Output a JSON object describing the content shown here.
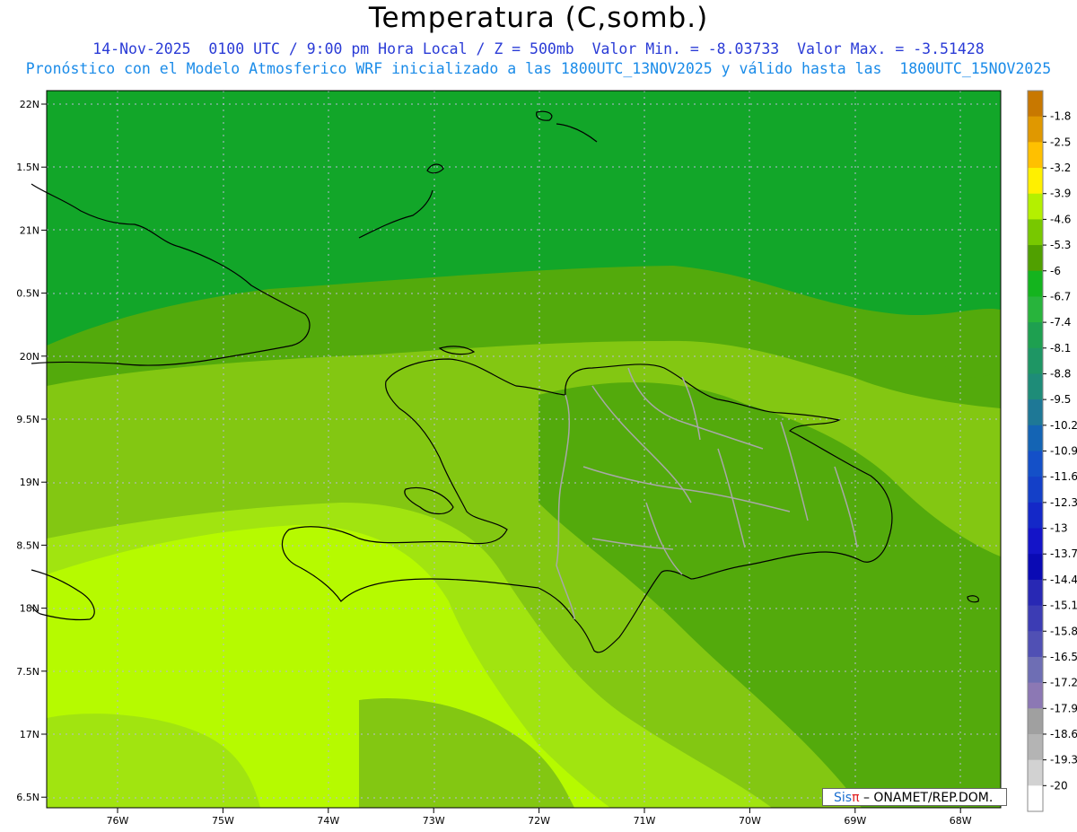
{
  "header": {
    "title": "Temperatura (C,somb.)",
    "info_line": "14-Nov-2025  0100 UTC / 9:00 pm Hora Local / Z = 500mb  Valor Min. = -8.03733  Valor Max. = -3.51428",
    "model_line": "Pronóstico con el Modelo Atmosferico WRF inicializado a las 1800UTC_13NOV2025 y válido hasta las  1800UTC_15NOV2025"
  },
  "map": {
    "lat_labels": [
      "22N",
      "1.5N",
      "21N",
      "0.5N",
      "20N",
      "9.5N",
      "19N",
      "8.5N",
      "18N",
      "7.5N",
      "17N",
      "6.5N"
    ],
    "lon_labels": [
      "76W",
      "75W",
      "74W",
      "73W",
      "72W",
      "71W",
      "70W",
      "69W",
      "68W"
    ],
    "colors": {
      "outer_green": "#12a629",
      "band_green": "#53aa0c",
      "mid_green": "#83c712",
      "light_green": "#a1e410",
      "lime": "#b6fa00",
      "coast": "#000000",
      "border": "#a8a8a8",
      "grid": "#b8b8d8"
    }
  },
  "colorbar": {
    "labels": [
      "-1.8",
      "-2.5",
      "-3.2",
      "-3.9",
      "-4.6",
      "-5.3",
      "-6",
      "-6.7",
      "-7.4",
      "-8.1",
      "-8.8",
      "-9.5",
      "-10.2",
      "-10.9",
      "-11.6",
      "-12.3",
      "-13",
      "-13.7",
      "-14.4",
      "-15.1",
      "-15.8",
      "-16.5",
      "-17.2",
      "-17.9",
      "-18.6",
      "-19.3",
      "-20"
    ],
    "colors": [
      "#c87800",
      "#e09800",
      "#ffc000",
      "#fff000",
      "#b4f000",
      "#78c800",
      "#50a000",
      "#14b41e",
      "#28b43c",
      "#1ea050",
      "#1e9664",
      "#1e8c78",
      "#1e7896",
      "#1464b4",
      "#1450c8",
      "#1440c8",
      "#1428c8",
      "#1414c8",
      "#0a0ab4",
      "#2828b4",
      "#3c3cb4",
      "#5050b4",
      "#6e6eb4",
      "#8c78b4",
      "#a0a0a0",
      "#b4b4b4",
      "#d2d2d2",
      "#ffffff"
    ]
  },
  "credit": {
    "brand": "Sis",
    "pi": "π",
    "text": " – ONAMET/REP.DOM."
  }
}
